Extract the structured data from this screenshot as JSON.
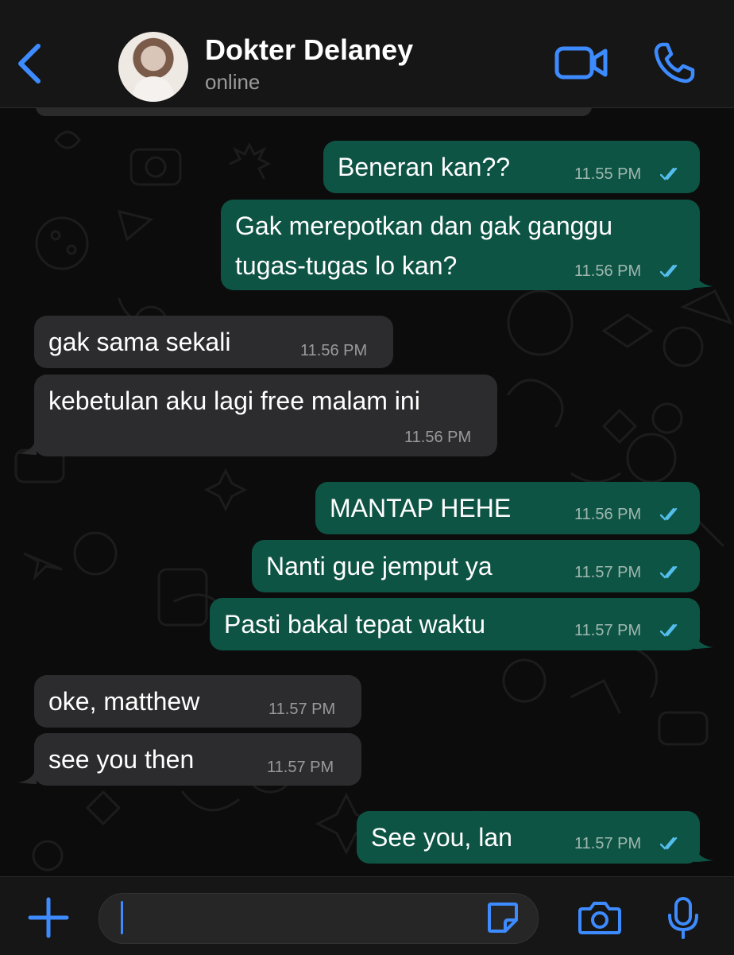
{
  "header": {
    "contact_name": "Dokter Delaney",
    "status": "online",
    "icons": [
      "chevron-left-icon",
      "video-camera-icon",
      "phone-icon"
    ]
  },
  "messages": [
    {
      "direction": "out",
      "text": [
        "Beneran kan??"
      ],
      "time": "11.55 PM",
      "read": true
    },
    {
      "direction": "out",
      "text": [
        "Gak merepotkan dan gak ganggu",
        "tugas-tugas lo kan?"
      ],
      "time": "11.56 PM",
      "read": true
    },
    {
      "direction": "in",
      "text": [
        "gak sama sekali"
      ],
      "time": "11.56 PM"
    },
    {
      "direction": "in",
      "text": [
        "kebetulan aku lagi free malam ini"
      ],
      "time": "11.56 PM"
    },
    {
      "direction": "out",
      "text": [
        "MANTAP HEHE"
      ],
      "time": "11.56 PM",
      "read": true
    },
    {
      "direction": "out",
      "text": [
        "Nanti gue jemput ya"
      ],
      "time": "11.57 PM",
      "read": true
    },
    {
      "direction": "out",
      "text": [
        "Pasti bakal tepat waktu"
      ],
      "time": "11.57 PM",
      "read": true
    },
    {
      "direction": "in",
      "text": [
        "oke, matthew"
      ],
      "time": "11.57 PM"
    },
    {
      "direction": "in",
      "text": [
        "see you then"
      ],
      "time": "11.57 PM"
    },
    {
      "direction": "out",
      "text": [
        "See you, lan"
      ],
      "time": "11.57 PM",
      "read": true
    }
  ],
  "composer": {
    "input_value": "",
    "icons": [
      "plus-icon",
      "sticker-icon",
      "camera-icon",
      "microphone-icon"
    ]
  },
  "colors": {
    "accent": "#3d8bff",
    "outgoing_bubble": "#0e5445",
    "incoming_bubble": "#2c2c2e",
    "read_ticks": "#53bdeb",
    "background": "#0b0b0b"
  }
}
